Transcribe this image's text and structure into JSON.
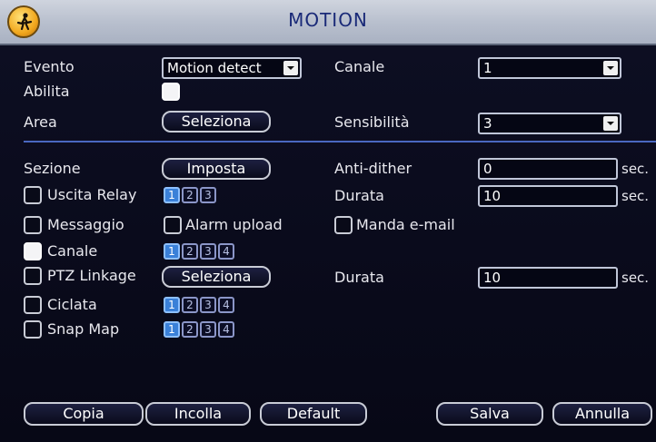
{
  "title": "MOTION",
  "labels": {
    "evento": "Evento",
    "abilita": "Abilita",
    "area": "Area",
    "canale": "Canale",
    "sensibilita": "Sensibilità",
    "sezione": "Sezione",
    "anti_dither": "Anti-dither",
    "durata": "Durata",
    "durata2": "Durata"
  },
  "fields": {
    "evento_value": "Motion detect",
    "canale_value": "1",
    "sensibilita_value": "3",
    "anti_dither_value": "0",
    "durata_value": "10",
    "durata2_value": "10"
  },
  "units": {
    "sec": "sec."
  },
  "buttons": {
    "area_select": "Seleziona",
    "sezione_set": "Imposta",
    "ptz_select": "Seleziona",
    "copia": "Copia",
    "incolla": "Incolla",
    "default": "Default",
    "salva": "Salva",
    "annulla": "Annulla"
  },
  "checks": {
    "uscita_relay": "Uscita Relay",
    "messaggio": "Messaggio",
    "alarm_upload": "Alarm upload",
    "manda_email": "Manda e-mail",
    "canale": "Canale",
    "ptz_linkage": "PTZ Linkage",
    "ciclata": "Ciclata",
    "snap_map": "Snap Map"
  },
  "channel_numbers": [
    "1",
    "2",
    "3",
    "4"
  ],
  "colors": {
    "accent": "#3a80d8",
    "title_text": "#1a2a78"
  }
}
